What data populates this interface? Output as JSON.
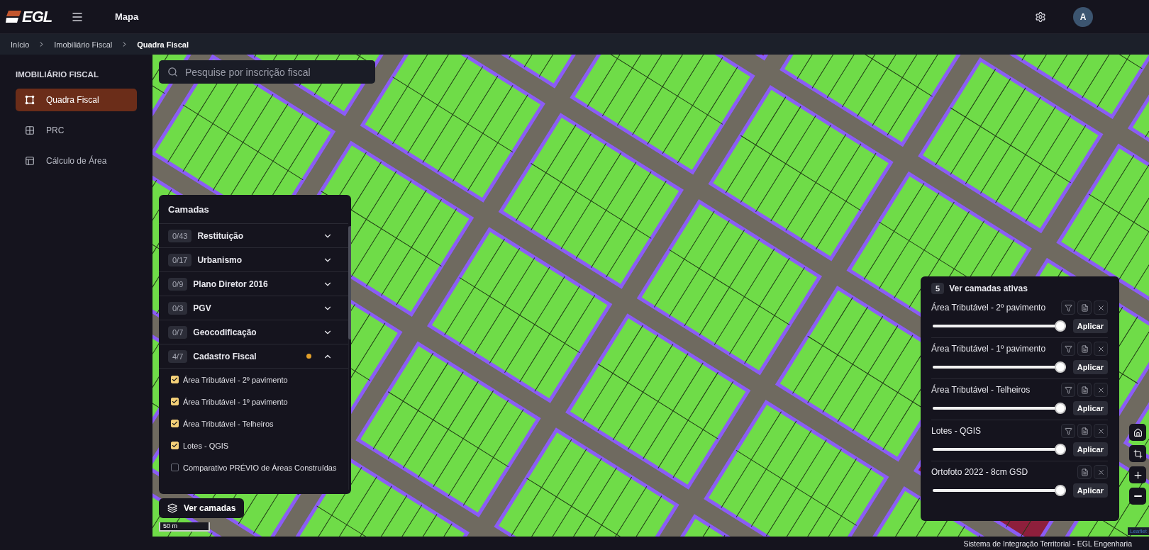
{
  "header": {
    "logo": "EGL",
    "title": "Mapa",
    "avatar": "A"
  },
  "breadcrumb": [
    {
      "label": "Início",
      "current": false
    },
    {
      "label": "Imobiliário Fiscal",
      "current": false
    },
    {
      "label": "Quadra Fiscal",
      "current": true
    }
  ],
  "sidebar": {
    "section": "IMOBILIÁRIO FISCAL",
    "items": [
      {
        "label": "Quadra Fiscal",
        "selected": true
      },
      {
        "label": "PRC",
        "selected": false
      },
      {
        "label": "Cálculo de Área",
        "selected": false
      }
    ]
  },
  "search": {
    "placeholder": "Pesquise por inscrição fiscal"
  },
  "layers_panel": {
    "title": "Camadas",
    "groups": [
      {
        "count": "0/43",
        "name": "Restituição",
        "expanded": false,
        "active": false
      },
      {
        "count": "0/17",
        "name": "Urbanismo",
        "expanded": false,
        "active": false
      },
      {
        "count": "0/9",
        "name": "Plano Diretor 2016",
        "expanded": false,
        "active": false
      },
      {
        "count": "0/3",
        "name": "PGV",
        "expanded": false,
        "active": false
      },
      {
        "count": "0/7",
        "name": "Geocodificação",
        "expanded": false,
        "active": false
      },
      {
        "count": "4/7",
        "name": "Cadastro Fiscal",
        "expanded": true,
        "active": true,
        "children": [
          {
            "label": "Área Tributável - 2º pavimento",
            "checked": true
          },
          {
            "label": "Área Tributável - 1º pavimento",
            "checked": true
          },
          {
            "label": "Área Tributável - Telheiros",
            "checked": true
          },
          {
            "label": "Lotes - QGIS",
            "checked": true
          },
          {
            "label": "Comparativo PRÉVIO de Áreas Construídas",
            "checked": false
          }
        ]
      }
    ]
  },
  "layers_button": "Ver camadas",
  "scale": "50 m",
  "active_layers": {
    "count": "5",
    "title": "Ver camadas ativas",
    "layers": [
      {
        "name": "Área Tributável - 2º pavimento",
        "has_filter": true,
        "level": 1,
        "apply": "Aplicar"
      },
      {
        "name": "Área Tributável - 1º pavimento",
        "has_filter": true,
        "level": 1,
        "apply": "Aplicar"
      },
      {
        "name": "Área Tributável - Telheiros",
        "has_filter": true,
        "level": 1,
        "apply": "Aplicar"
      },
      {
        "name": "Lotes - QGIS",
        "has_filter": true,
        "level": 1,
        "apply": "Aplicar"
      },
      {
        "name": "Ortofoto 2022 - 8cm GSD",
        "has_filter": false,
        "level": 1,
        "apply": "Aplicar"
      }
    ]
  },
  "attribution": "Leaflet",
  "footer": "Sistema de Integração Territorial - EGL Engenharia"
}
